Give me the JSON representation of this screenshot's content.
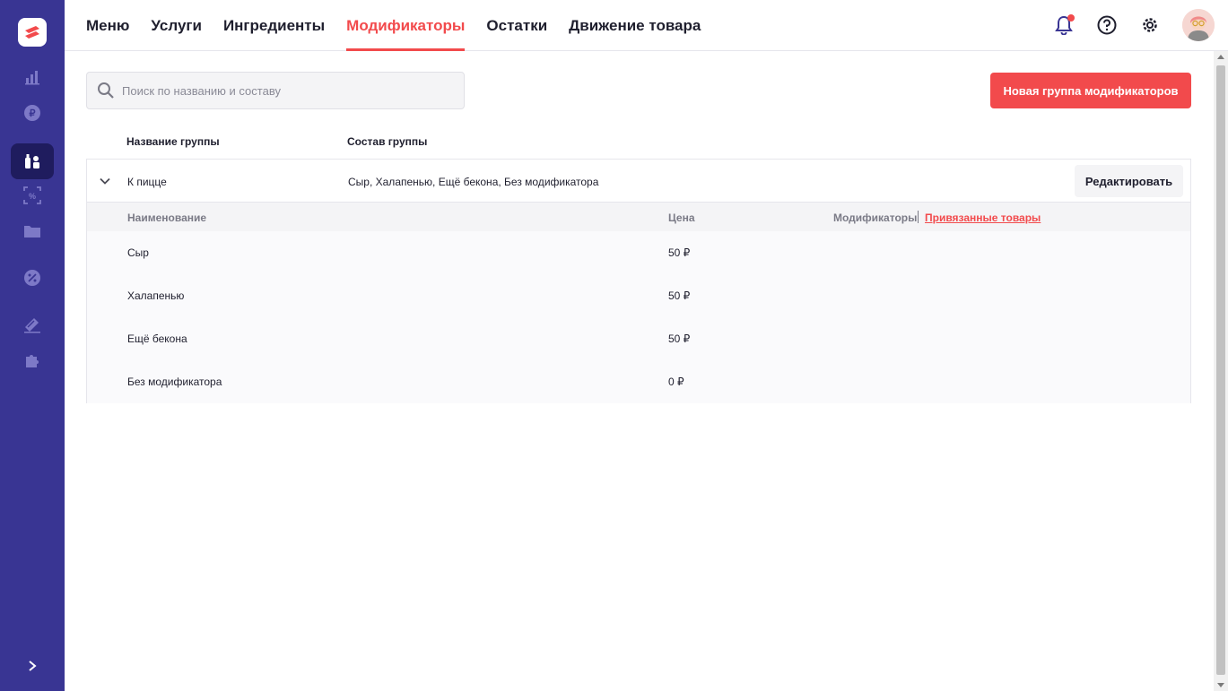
{
  "nav": {
    "tabs": [
      {
        "label": "Меню"
      },
      {
        "label": "Услуги"
      },
      {
        "label": "Ингредиенты"
      },
      {
        "label": "Модификаторы",
        "active": true
      },
      {
        "label": "Остатки"
      },
      {
        "label": "Движение товара"
      }
    ]
  },
  "sidebar": {
    "icons": [
      "logo-icon",
      "stats-icon",
      "ruble-icon",
      "menu-items-icon",
      "discount-icon",
      "folder-icon",
      "promo-icon",
      "marketing-icon",
      "integrations-icon",
      "expand-icon"
    ]
  },
  "search": {
    "placeholder": "Поиск по названию и составу"
  },
  "toolbar": {
    "new_group_label": "Новая группа модификаторов"
  },
  "table": {
    "headers": {
      "name": "Название группы",
      "composition": "Состав группы"
    },
    "group": {
      "name": "К пицце",
      "composition": "Сыр, Халапенью, Ещё бекона, Без модификатора",
      "edit_label": "Редактировать"
    },
    "sub_headers": {
      "name": "Наименование",
      "price": "Цена",
      "modifiers": "Модификаторы",
      "linked": "Привязанные товары"
    },
    "items": [
      {
        "name": "Сыр",
        "price": "50 ₽"
      },
      {
        "name": "Халапенью",
        "price": "50 ₽"
      },
      {
        "name": "Ещё бекона",
        "price": "50 ₽"
      },
      {
        "name": "Без модификатора",
        "price": "0 ₽"
      }
    ]
  },
  "colors": {
    "sidebar": "#393593",
    "accent": "#f24a4c"
  }
}
